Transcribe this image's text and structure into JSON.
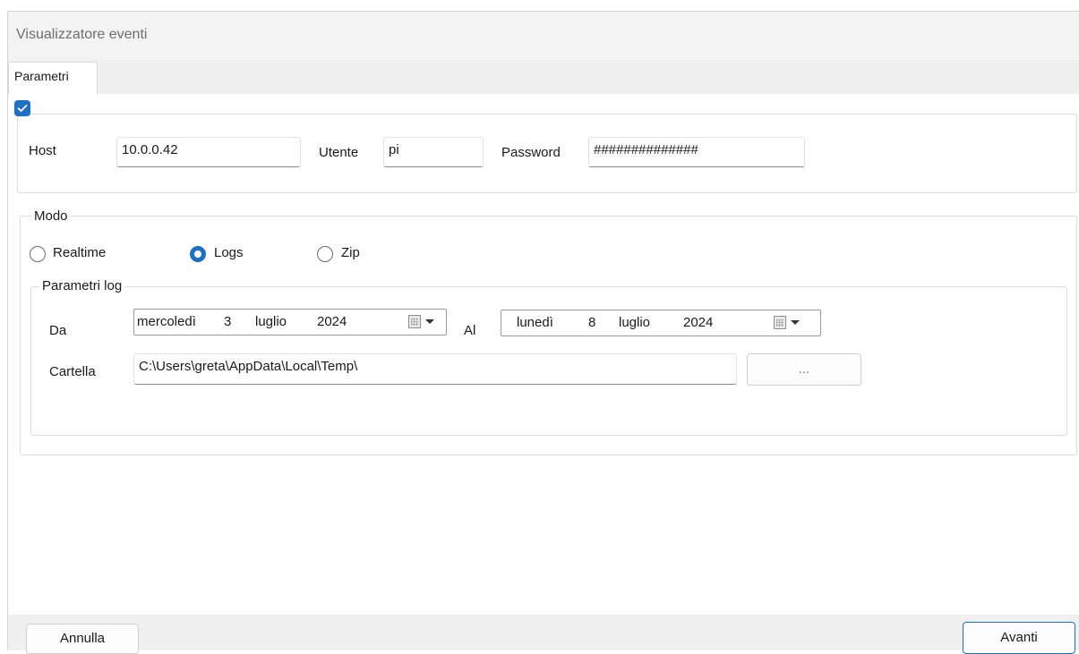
{
  "window": {
    "title": "Visualizzatore eventi"
  },
  "tabs": [
    {
      "label": "Parametri"
    }
  ],
  "connection": {
    "enabled": true,
    "host_label": "Host",
    "host_value": "10.0.0.42",
    "user_label": "Utente",
    "user_value": "pi",
    "password_label": "Password",
    "password_value": "##############"
  },
  "mode": {
    "legend": "Modo",
    "options": [
      {
        "label": "Realtime",
        "selected": false
      },
      {
        "label": "Logs",
        "selected": true
      },
      {
        "label": "Zip",
        "selected": false
      }
    ]
  },
  "log_params": {
    "legend": "Parametri log",
    "from_label": "Da",
    "from_date": {
      "weekday": "mercoledì",
      "day": "3",
      "month": "luglio",
      "year": "2024"
    },
    "to_label": "Al",
    "to_date": {
      "weekday": "lunedì",
      "day": "8",
      "month": "luglio",
      "year": "2024"
    },
    "folder_label": "Cartella",
    "folder_value": "C:\\Users\\greta\\AppData\\Local\\Temp\\",
    "browse_label": "..."
  },
  "footer": {
    "cancel_label": "Annulla",
    "next_label": "Avanti"
  },
  "colors": {
    "accent": "#1f6fc4",
    "window_bg": "#f0f0f0",
    "page_bg": "#ffffff"
  },
  "icons": [
    "checkbox-checked-icon",
    "calendar-icon",
    "chevron-down-icon"
  ]
}
